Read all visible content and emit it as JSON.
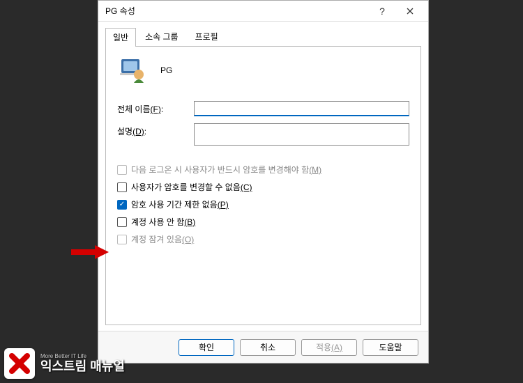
{
  "dialog": {
    "title": "PG 속성"
  },
  "tabs": {
    "general": "일반",
    "groups": "소속 그룹",
    "profile": "프로필"
  },
  "user": {
    "name": "PG"
  },
  "fields": {
    "full_name_label": "전체 이름",
    "full_name_mnemonic": "(F)",
    "full_name_value": "",
    "description_label": "설명",
    "description_mnemonic": "(D)",
    "description_value": ""
  },
  "checks": {
    "must_change": {
      "label": "다음 로그온 시 사용자가 반드시 암호를 변경해야 함",
      "mnemonic": "(M)",
      "checked": false,
      "disabled": true
    },
    "cannot_change": {
      "label": "사용자가 암호를 변경할 수 없음",
      "mnemonic": "(C)",
      "checked": false,
      "disabled": false
    },
    "never_expires": {
      "label": "암호 사용 기간 제한 없음",
      "mnemonic": "(P)",
      "checked": true,
      "disabled": false
    },
    "disabled_account": {
      "label": "계정 사용 안 함",
      "mnemonic": "(B)",
      "checked": false,
      "disabled": false
    },
    "locked": {
      "label": "계정 잠겨 있음",
      "mnemonic": "(O)",
      "checked": false,
      "disabled": true
    }
  },
  "buttons": {
    "ok": "확인",
    "cancel": "취소",
    "apply_label": "적용",
    "apply_mnemonic": "(A)",
    "help": "도움말"
  },
  "logo": {
    "tagline": "More Better IT Life",
    "name": "익스트림 매뉴얼"
  },
  "colors": {
    "accent": "#0067c0",
    "arrow": "#d40000"
  }
}
